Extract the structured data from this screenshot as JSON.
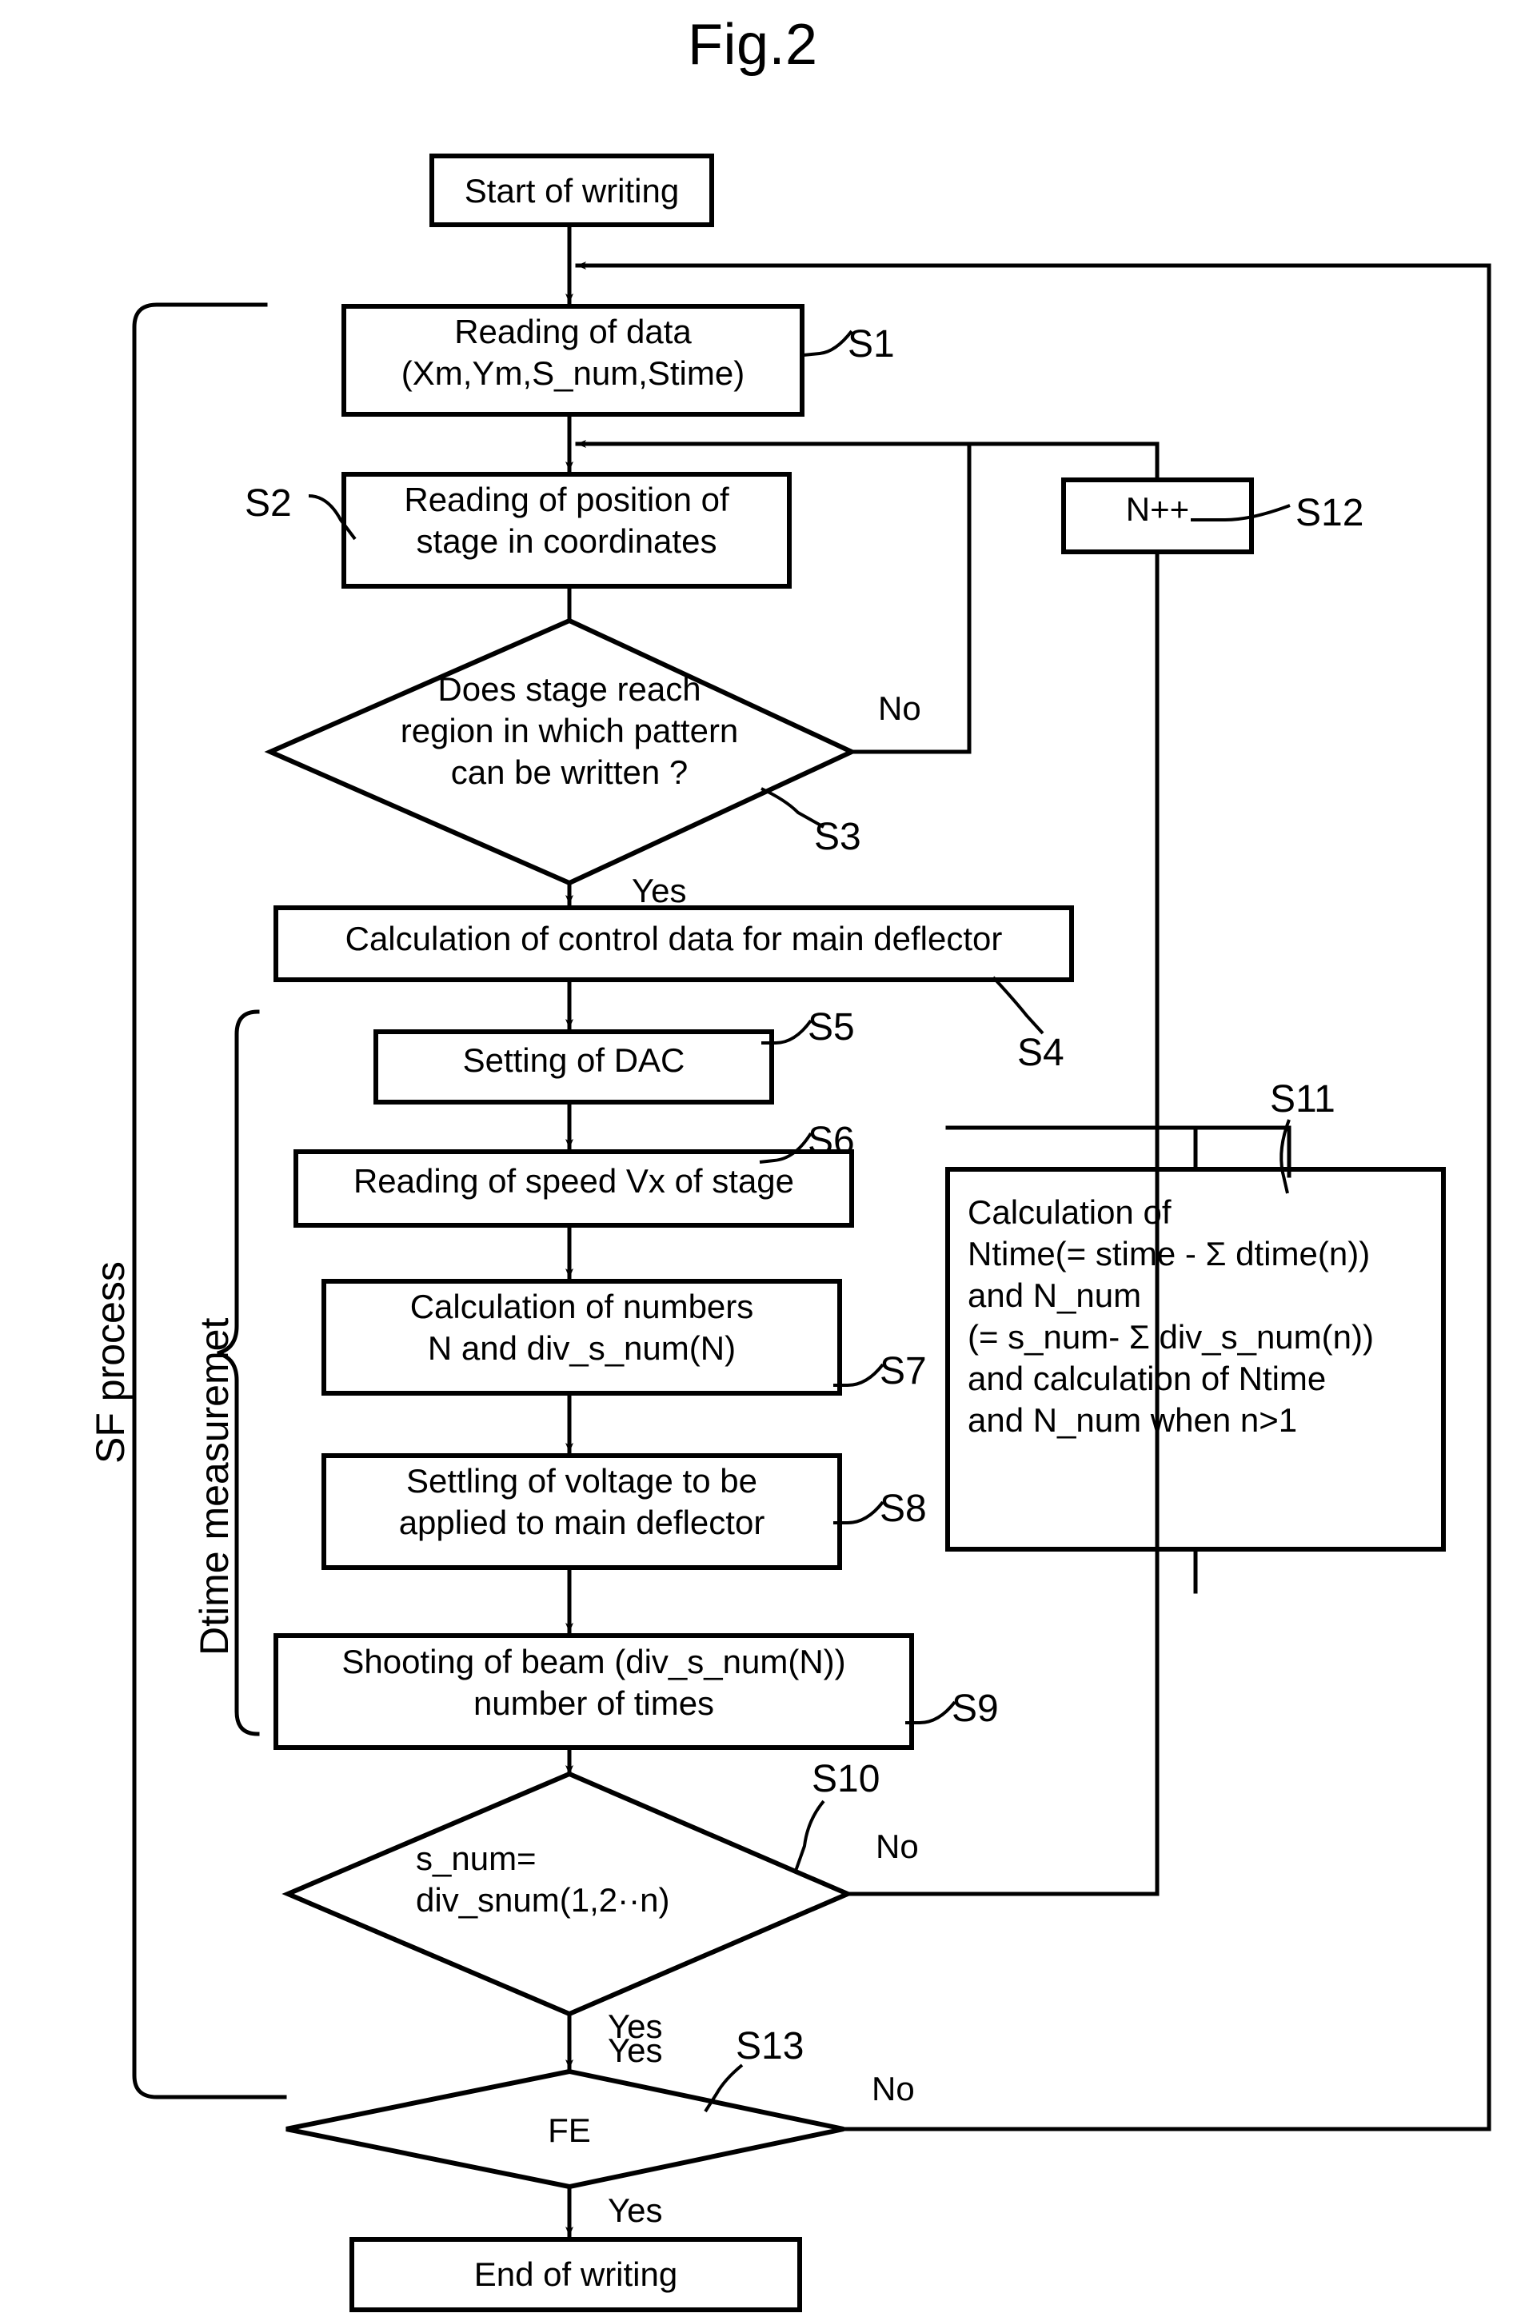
{
  "figure": {
    "title": "Fig.2",
    "type": "flowchart"
  },
  "group_labels": {
    "sf_process": "SF process",
    "dtime_measurement": "Dtime measuremet"
  },
  "nodes": {
    "start": {
      "shape": "terminator",
      "text": "Start of writing"
    },
    "s1": {
      "shape": "process",
      "ref": "S1",
      "line1": "Reading of data",
      "line2": "(Xm,Ym,S_num,Stime)"
    },
    "s2": {
      "shape": "process",
      "ref": "S2",
      "line1": "Reading of position of",
      "line2": "stage in coordinates"
    },
    "s3": {
      "shape": "decision",
      "ref": "S3",
      "line1": "Does stage reach",
      "line2": "region in which pattern",
      "line3": "can be written ?",
      "yes": "Yes",
      "no": "No"
    },
    "s4": {
      "shape": "process",
      "ref": "S4",
      "line1": "Calculation of control data for main deflector"
    },
    "s5": {
      "shape": "process",
      "ref": "S5",
      "line1": "Setting of DAC"
    },
    "s6": {
      "shape": "process",
      "ref": "S6",
      "line1": "Reading of speed Vx of stage"
    },
    "s7": {
      "shape": "process",
      "ref": "S7",
      "line1": "Calculation of numbers",
      "line2": "N and div_s_num(N)"
    },
    "s8": {
      "shape": "process",
      "ref": "S8",
      "line1": "Settling of voltage to be",
      "line2": "applied to main deflector"
    },
    "s9": {
      "shape": "process",
      "ref": "S9",
      "line1": "Shooting of beam (div_s_num(N))",
      "line2": "number of times"
    },
    "s10": {
      "shape": "decision",
      "ref": "S10",
      "line1": "s_num=",
      "line2": "div_snum(1,2··n)",
      "yes": "Yes",
      "no": "No"
    },
    "s11": {
      "shape": "process",
      "ref": "S11",
      "line1": "Calculation of",
      "line2": "Ntime(= stime - Σ dtime(n))",
      "line3": "and N_num",
      "line4": "(= s_num- Σ div_s_num(n))",
      "line5": "and calculation of Ntime",
      "line6": "and N_num when n>1"
    },
    "s12": {
      "shape": "process",
      "ref": "S12",
      "line1": "N++"
    },
    "s13": {
      "shape": "decision",
      "ref": "S13",
      "line1": "FE",
      "yes": "Yes",
      "no": "No"
    },
    "end": {
      "shape": "terminator",
      "text": "End of writing"
    }
  },
  "colors": {
    "stroke": "#000000",
    "background": "#ffffff",
    "text": "#000000"
  }
}
